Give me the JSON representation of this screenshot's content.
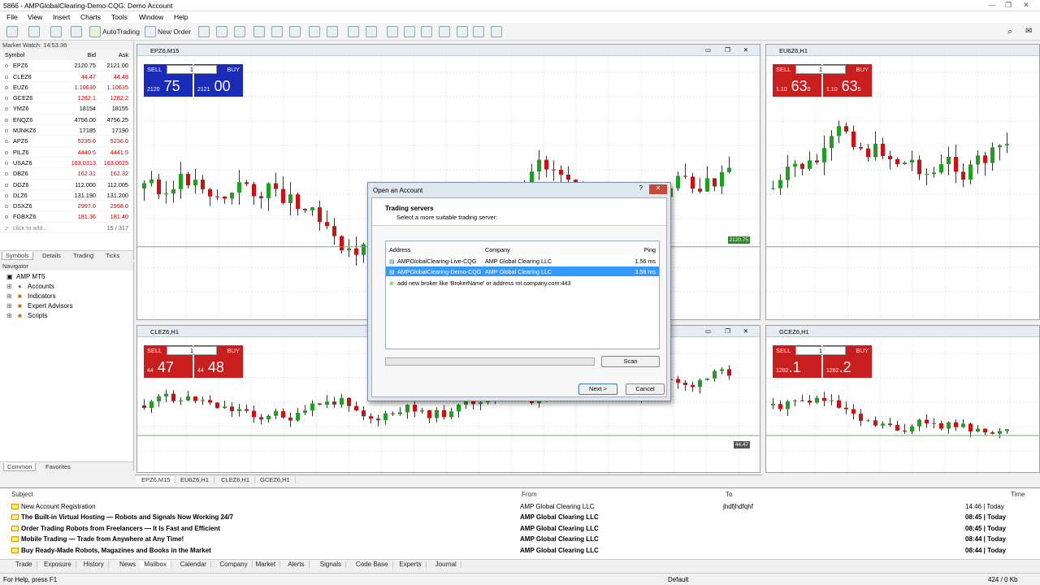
{
  "window": {
    "title": "5866 - AMPGlobalClearing-Demo-CQG: Demo Account"
  },
  "menu": [
    "File",
    "View",
    "Insert",
    "Charts",
    "Tools",
    "Window",
    "Help"
  ],
  "toolbar": {
    "autotrading": "AutoTrading",
    "new_order": "New Order"
  },
  "market_watch": {
    "title": "Market Watch: 14:53:36",
    "col_symbol": "Symbol",
    "col_bid": "Bid",
    "col_ask": "Ask",
    "rows": [
      {
        "symbol": "EPZ6",
        "bid": "2120.75",
        "ask": "2121.00",
        "dir": "n"
      },
      {
        "symbol": "CLEZ6",
        "bid": "44.47",
        "ask": "44.48",
        "dir": "r"
      },
      {
        "symbol": "EUZ6",
        "bid": "1.10630",
        "ask": "1.10635",
        "dir": "r"
      },
      {
        "symbol": "GCEZ6",
        "bid": "1282.1",
        "ask": "1282.2",
        "dir": "r"
      },
      {
        "symbol": "YMZ6",
        "bid": "18154",
        "ask": "18155",
        "dir": "n"
      },
      {
        "symbol": "ENQZ6",
        "bid": "4756.00",
        "ask": "4756.25",
        "dir": "n"
      },
      {
        "symbol": "MJNKZ6",
        "bid": "17185",
        "ask": "17190",
        "dir": "n"
      },
      {
        "symbol": "APZ6",
        "bid": "5235.0",
        "ask": "5236.0",
        "dir": "r"
      },
      {
        "symbol": "PILZ6",
        "bid": "4440.5",
        "ask": "4441.5",
        "dir": "r"
      },
      {
        "symbol": "USAZ6",
        "bid": "163.0313",
        "ask": "163.0625",
        "dir": "r"
      },
      {
        "symbol": "DBZ6",
        "bid": "162.31",
        "ask": "162.32",
        "dir": "r"
      },
      {
        "symbol": "DGZ6",
        "bid": "112.000",
        "ask": "112.005",
        "dir": "n"
      },
      {
        "symbol": "DLZ6",
        "bid": "131.190",
        "ask": "131.200",
        "dir": "n"
      },
      {
        "symbol": "DSXZ6",
        "bid": "2997.0",
        "ask": "2998.0",
        "dir": "r"
      },
      {
        "symbol": "FGBXZ6",
        "bid": "181.36",
        "ask": "181.40",
        "dir": "r"
      }
    ],
    "add_hint": "click to add...",
    "count": "15 / 317",
    "tabs": [
      "Symbols",
      "Details",
      "Trading",
      "Ticks"
    ]
  },
  "navigator": {
    "title": "Navigator",
    "root": "AMP MT5",
    "items": [
      "Accounts",
      "Indicators",
      "Expert Advisors",
      "Scripts"
    ],
    "tabs": [
      "Common",
      "Favorites"
    ]
  },
  "charts": [
    {
      "title": "EPZ6,M15",
      "sell_label": "SELL",
      "buy_label": "BUY",
      "lot": "1",
      "sell_small": "2120",
      "sell_big": "75",
      "buy_small": "2121",
      "buy_big": "00",
      "price_tag": "2120.75"
    },
    {
      "title": "EU6Z6,H1",
      "sell_label": "SELL",
      "buy_label": "BUY",
      "lot": "1",
      "sell_small": "1.10",
      "sell_big": "63",
      "sell_sup": "0",
      "buy_small": "1.10",
      "buy_big": "63",
      "buy_sup": "5"
    },
    {
      "title": "CLEZ6,H1",
      "sell_label": "SELL",
      "buy_label": "BUY",
      "lot": "1",
      "sell_small": "44",
      "sell_big": "47",
      "buy_small": "44",
      "buy_big": "48",
      "price_tag": "44.47"
    },
    {
      "title": "GCEZ6,H1",
      "sell_label": "SELL",
      "buy_label": "BUY",
      "lot": "1",
      "sell_small": "1282",
      "sell_big": ".1",
      "buy_small": "1282",
      "buy_big": ".2"
    }
  ],
  "chart_tabs": [
    "EPZ6,M15",
    "EU6Z6,H1",
    "CLEZ6,H1",
    "GCEZ6,H1"
  ],
  "dialog": {
    "title": "Open an Account",
    "heading": "Trading servers",
    "subheading": "Select a more suitable trading server:",
    "col_address": "Address",
    "col_company": "Company",
    "col_ping": "Ping",
    "servers": [
      {
        "address": "AMPGlobalClearing-Live-CQG",
        "company": "AMP Global Clearing LLC",
        "ping": "1.56 ms"
      },
      {
        "address": "AMPGlobalClearing-Demo-CQG",
        "company": "AMP Global Clearing LLC",
        "ping": "3.58 ms"
      }
    ],
    "add_hint": "add new broker like 'BrokerName' or address mt.company.com:443",
    "scan": "Scan",
    "next": "Next >",
    "cancel": "Cancel"
  },
  "mailbox": {
    "col_subject": "Subject",
    "col_from": "From",
    "col_to": "To",
    "col_time": "Time",
    "rows": [
      {
        "subject": "New Account Registration",
        "from": "AMP Global Clearing LLC",
        "to": "jhdfjhdfqhf",
        "time": "14:46 | Today",
        "bold": false
      },
      {
        "subject": "The Built-in Virtual Hosting — Robots and Signals Now Working 24/7",
        "from": "AMP Global Clearing LLC",
        "to": "",
        "time": "08:45 | Today",
        "bold": true
      },
      {
        "subject": "Order Trading Robots from Freelancers — It Is Fast and Efficient",
        "from": "AMP Global Clearing LLC",
        "to": "",
        "time": "08:45 | Today",
        "bold": true
      },
      {
        "subject": "Mobile Trading — Trade from Anywhere at Any Time!",
        "from": "AMP Global Clearing LLC",
        "to": "",
        "time": "08:44 | Today",
        "bold": true
      },
      {
        "subject": "Buy Ready-Made Robots, Magazines and Books in the Market",
        "from": "AMP Global Clearing LLC",
        "to": "",
        "time": "08:44 | Today",
        "bold": true
      }
    ]
  },
  "terminal_tabs": [
    "Trade",
    "Exposure",
    "History",
    "News",
    "Mailbox",
    "Calendar",
    "Company",
    "Market",
    "Alerts",
    "Signals",
    "Code Base",
    "Experts",
    "Journal"
  ],
  "status": {
    "help": "For Help, press F1",
    "profile": "Default",
    "traffic": "424 / 0 Kb"
  }
}
